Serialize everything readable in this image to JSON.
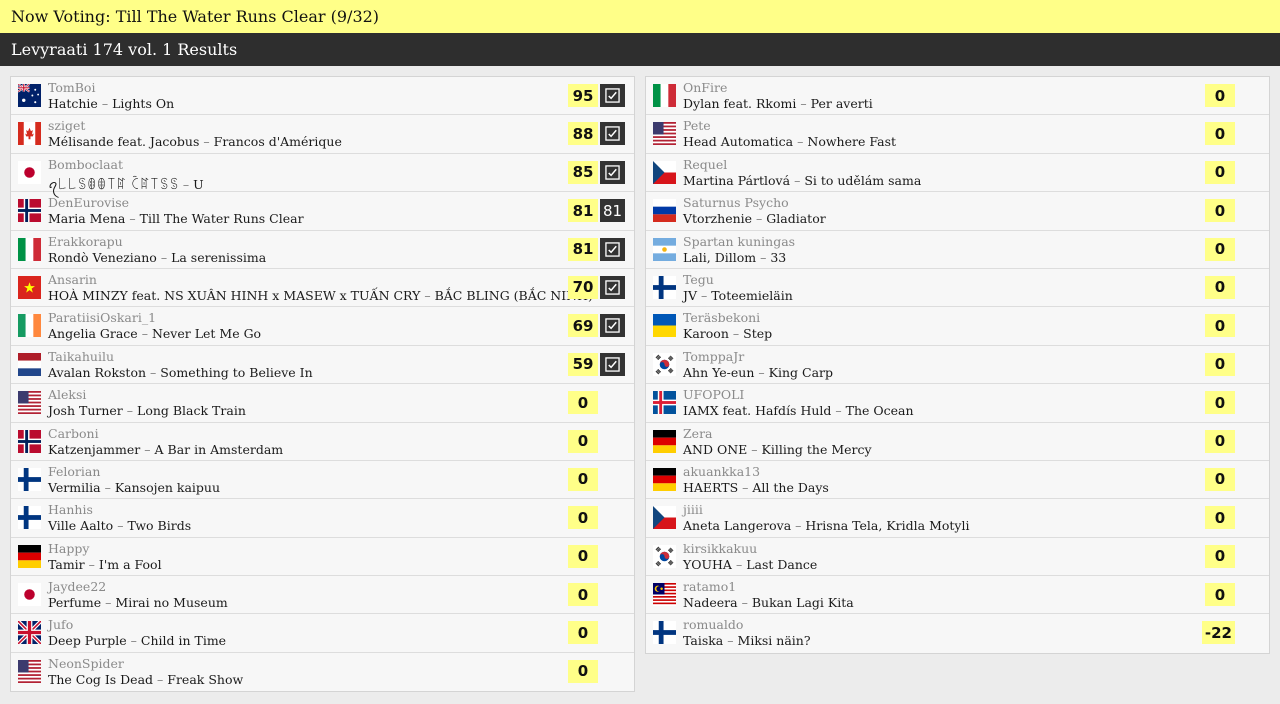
{
  "topbar": {
    "text": "Now Voting: Till The Water Runs Clear (9/32)"
  },
  "subbar": {
    "title": "Levyraati 174 vol. 1 Results"
  },
  "left": [
    {
      "flag": "au",
      "user": "TomBoi",
      "artist": "Hatchie",
      "title": "Lights On",
      "score": "95",
      "check": "icon"
    },
    {
      "flag": "ca",
      "user": "sziget",
      "artist": "Mélisande feat. Jacobus",
      "title": "Francos d'Amérique",
      "score": "88",
      "check": "icon"
    },
    {
      "flag": "jp",
      "user": "Bomboclaat",
      "artist": "ꪖ꒒꒒ꌗꂦꂦ꓄ꍏ ꉓꍏ꓄ꌗꌗ",
      "title": "U",
      "score": "85",
      "check": "icon"
    },
    {
      "flag": "no",
      "user": "DenEurovise",
      "artist": "Maria Mena",
      "title": "Till The Water Runs Clear",
      "score": "81",
      "check": "81"
    },
    {
      "flag": "it",
      "user": "Erakkorapu",
      "artist": "Rondò Veneziano",
      "title": "La serenissima",
      "score": "81",
      "check": "icon"
    },
    {
      "flag": "vn",
      "user": "Ansarin",
      "artist": "HOÀ MINZY feat. NS XUÂN HINH x MASEW x TUẤN CRY",
      "title": "BẮC BLING (BẮC NINH)",
      "score": "70",
      "check": "icon"
    },
    {
      "flag": "ie",
      "user": "ParatiisiOskari_1",
      "artist": "Angelia Grace",
      "title": "Never Let Me Go",
      "score": "69",
      "check": "icon"
    },
    {
      "flag": "nl",
      "user": "Taikahuilu",
      "artist": "Avalan Rokston",
      "title": "Something to Believe In",
      "score": "59",
      "check": "icon"
    },
    {
      "flag": "us",
      "user": "Aleksi",
      "artist": "Josh Turner",
      "title": "Long Black Train",
      "score": "0",
      "check": ""
    },
    {
      "flag": "no",
      "user": "Carboni",
      "artist": "Katzenjammer",
      "title": "A Bar in Amsterdam",
      "score": "0",
      "check": ""
    },
    {
      "flag": "fi",
      "user": "Felorian",
      "artist": "Vermilia",
      "title": "Kansojen kaipuu",
      "score": "0",
      "check": ""
    },
    {
      "flag": "fi",
      "user": "Hanhis",
      "artist": "Ville Aalto",
      "title": "Two Birds",
      "score": "0",
      "check": ""
    },
    {
      "flag": "de",
      "user": "Happy",
      "artist": "Tamir",
      "title": "I'm a Fool",
      "score": "0",
      "check": ""
    },
    {
      "flag": "jp",
      "user": "Jaydee22",
      "artist": "Perfume",
      "title": "Mirai no Museum",
      "score": "0",
      "check": ""
    },
    {
      "flag": "gb",
      "user": "Jufo",
      "artist": "Deep Purple",
      "title": "Child in Time",
      "score": "0",
      "check": ""
    },
    {
      "flag": "us",
      "user": "NeonSpider",
      "artist": "The Cog Is Dead",
      "title": "Freak Show",
      "score": "0",
      "check": ""
    }
  ],
  "right": [
    {
      "flag": "it",
      "user": "OnFire",
      "artist": "Dylan feat. Rkomi",
      "title": "Per averti",
      "score": "0"
    },
    {
      "flag": "us",
      "user": "Pete",
      "artist": "Head Automatica",
      "title": "Nowhere Fast",
      "score": "0"
    },
    {
      "flag": "cz",
      "user": "Requel",
      "artist": "Martina Pártlová",
      "title": "Si to udělám sama",
      "score": "0"
    },
    {
      "flag": "ru",
      "user": "Saturnus Psycho",
      "artist": "Vtorzhenie",
      "title": "Gladiator",
      "score": "0"
    },
    {
      "flag": "ar",
      "user": "Spartan kuningas",
      "artist": "Lali, Dillom",
      "title": "33",
      "score": "0"
    },
    {
      "flag": "fi",
      "user": "Tegu",
      "artist": "JV",
      "title": "Toteemieläin",
      "score": "0"
    },
    {
      "flag": "ua",
      "user": "Teräsbekoni",
      "artist": "Karoon",
      "title": "Step",
      "score": "0"
    },
    {
      "flag": "kr",
      "user": "TomppaJr",
      "artist": "Ahn Ye-eun",
      "title": "King Carp",
      "score": "0"
    },
    {
      "flag": "is",
      "user": "UFOPOLI",
      "artist": "IAMX feat. Hafdís Huld",
      "title": "The Ocean",
      "score": "0"
    },
    {
      "flag": "de",
      "user": "Zera",
      "artist": "AND ONE",
      "title": "Killing the Mercy",
      "score": "0"
    },
    {
      "flag": "de",
      "user": "akuankka13",
      "artist": "HAERTS",
      "title": "All the Days",
      "score": "0"
    },
    {
      "flag": "cz",
      "user": "jiiii",
      "artist": "Aneta Langerova",
      "title": "Hrisna Tela, Kridla Motyli",
      "score": "0"
    },
    {
      "flag": "kr",
      "user": "kirsikkakuu",
      "artist": "YOUHA",
      "title": "Last Dance",
      "score": "0"
    },
    {
      "flag": "my",
      "user": "ratamo1",
      "artist": "Nadeera",
      "title": "Bukan Lagi Kita",
      "score": "0"
    },
    {
      "flag": "fi",
      "user": "romualdo",
      "artist": "Taiska",
      "title": "Miksi näin?",
      "score": "-22"
    }
  ],
  "colors": {
    "highlight": "#ffff88",
    "header": "#2e2e2e",
    "check_bg": "#333333"
  },
  "separator": "–"
}
